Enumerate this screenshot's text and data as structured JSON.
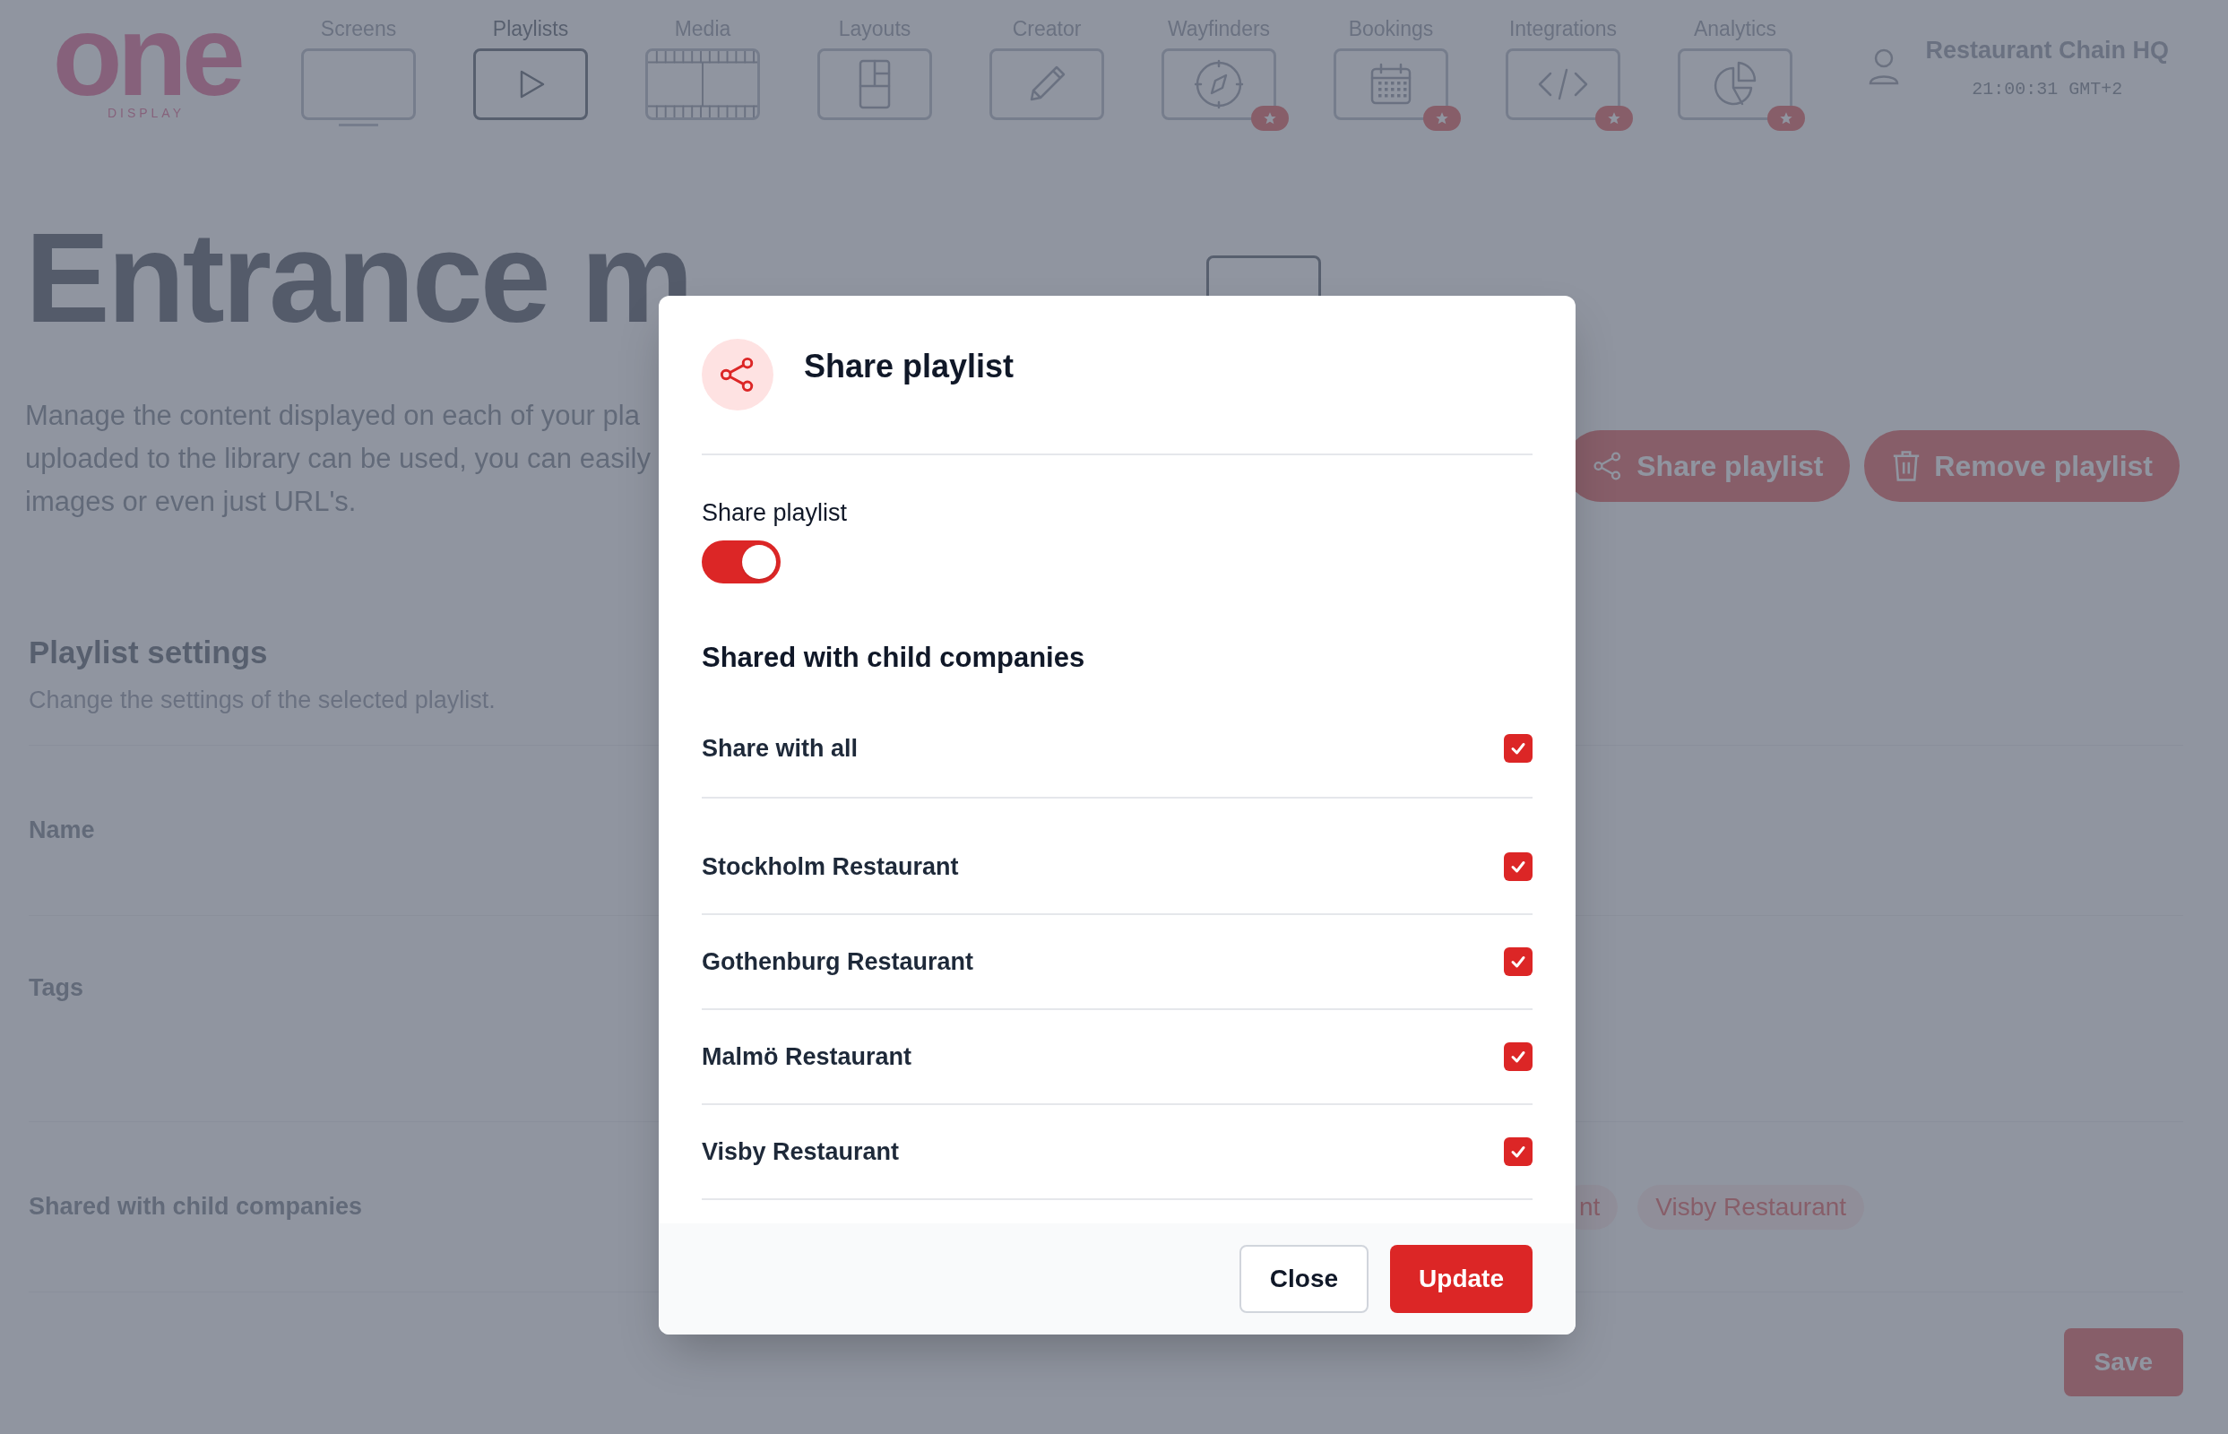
{
  "logo": {
    "text": "one",
    "subtitle": "DISPLAY"
  },
  "nav": [
    {
      "label": "Screens",
      "selected": false,
      "premium": false
    },
    {
      "label": "Playlists",
      "selected": true,
      "premium": false
    },
    {
      "label": "Media",
      "selected": false,
      "premium": false
    },
    {
      "label": "Layouts",
      "selected": false,
      "premium": false
    },
    {
      "label": "Creator",
      "selected": false,
      "premium": false
    },
    {
      "label": "Wayfinders",
      "selected": false,
      "premium": true
    },
    {
      "label": "Bookings",
      "selected": false,
      "premium": true
    },
    {
      "label": "Integrations",
      "selected": false,
      "premium": true
    },
    {
      "label": "Analytics",
      "selected": false,
      "premium": true
    }
  ],
  "user": {
    "name": "Restaurant Chain HQ",
    "time": "21:00:31 GMT+2"
  },
  "page": {
    "title": "Entrance m",
    "description_lines": [
      "Manage the content displayed on each of your pla",
      "uploaded to the library can be used, you can easily",
      "images or even just URL's."
    ],
    "actions": [
      "Share playlist",
      "Remove playlist"
    ],
    "settings": {
      "title": "Playlist settings",
      "subtitle": "Change the settings of the selected playlist.",
      "rows": [
        {
          "label": "Name",
          "tags": []
        },
        {
          "label": "Tags",
          "tags": []
        },
        {
          "label": "Shared with child companies",
          "tags": [
            "nt",
            "Visby Restaurant"
          ]
        }
      ]
    },
    "save": "Save"
  },
  "modal": {
    "title": "Share playlist",
    "toggle": {
      "label": "Share playlist",
      "on": true
    },
    "section_title": "Shared with child companies",
    "share_all": {
      "label": "Share with all",
      "checked": true
    },
    "companies": [
      {
        "label": "Stockholm Restaurant",
        "checked": true
      },
      {
        "label": "Gothenburg Restaurant",
        "checked": true
      },
      {
        "label": "Malmö Restaurant",
        "checked": true
      },
      {
        "label": "Visby Restaurant",
        "checked": true
      }
    ],
    "buttons": [
      "Close",
      "Update"
    ]
  }
}
